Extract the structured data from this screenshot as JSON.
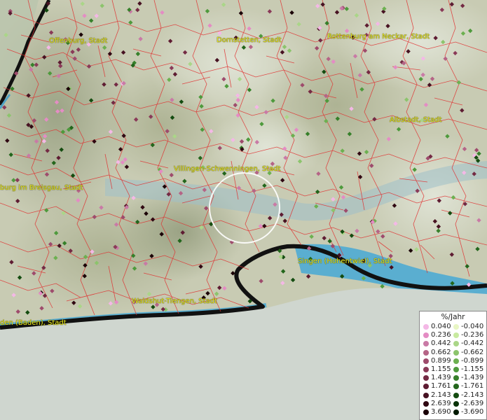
{
  "map": {
    "cities": [
      {
        "name": "Offenburg, Stadt"
      },
      {
        "name": "Dornstetten, Stadt"
      },
      {
        "name": "Rottenburg am Neckar, Stadt"
      },
      {
        "name": "Albstadt, Stadt"
      },
      {
        "name": "Villingen-Schwenningen, Stadt"
      },
      {
        "name": "burg im Breisgau, Stadt"
      },
      {
        "name": "Singen (Hohentwiel), Stadt"
      },
      {
        "name": "Waldshut-Tiengen, Stadt"
      },
      {
        "name": "den (Baden), Stadt"
      }
    ],
    "colors": {
      "boundary": "#e03030",
      "lake": "#4fa3c6",
      "coast": "#111111",
      "label": "#e6e61e"
    }
  },
  "legend": {
    "title": "%/Jahr",
    "positive": [
      {
        "label": "0.040",
        "color": "#f4b8e6"
      },
      {
        "label": "0.236",
        "color": "#e48cc4"
      },
      {
        "label": "0.442",
        "color": "#c97aa6"
      },
      {
        "label": "0.662",
        "color": "#b56486"
      },
      {
        "label": "0.899",
        "color": "#9e4b6c"
      },
      {
        "label": "1.155",
        "color": "#8a3a58"
      },
      {
        "label": "1.439",
        "color": "#742a44"
      },
      {
        "label": "1.761",
        "color": "#5e1c32"
      },
      {
        "label": "2.143",
        "color": "#471222"
      },
      {
        "label": "2.639",
        "color": "#300812"
      },
      {
        "label": "3.690",
        "color": "#1a0006"
      }
    ],
    "negative": [
      {
        "label": "-0.040",
        "color": "#e8f6c4"
      },
      {
        "label": "-0.236",
        "color": "#c8eaa0"
      },
      {
        "label": "-0.442",
        "color": "#aad688"
      },
      {
        "label": "-0.662",
        "color": "#8cc46c"
      },
      {
        "label": "-0.899",
        "color": "#6cb050"
      },
      {
        "label": "-1.155",
        "color": "#4e9a3c"
      },
      {
        "label": "-1.439",
        "color": "#36802a"
      },
      {
        "label": "-1.761",
        "color": "#23661c"
      },
      {
        "label": "-2.143",
        "color": "#144c10"
      },
      {
        "label": "-2.639",
        "color": "#093208"
      },
      {
        "label": "-3.690",
        "color": "#021a02"
      }
    ]
  }
}
